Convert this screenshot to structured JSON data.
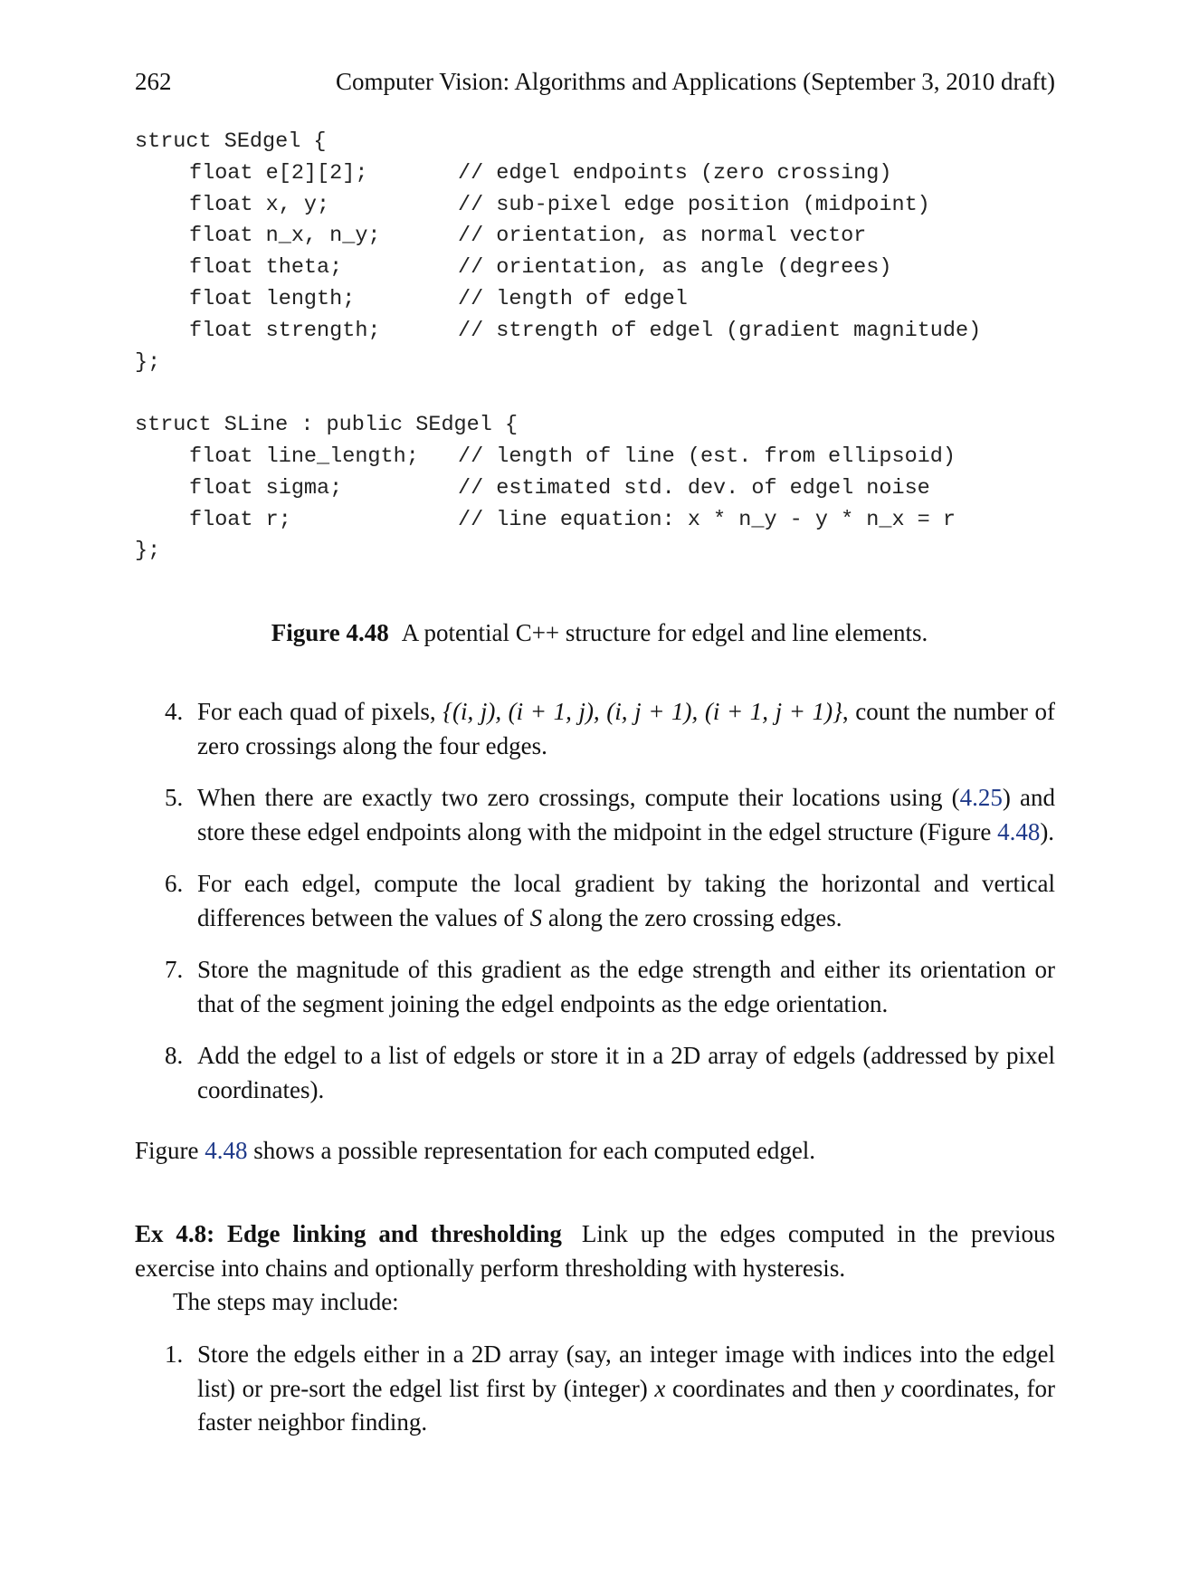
{
  "header": {
    "page_number": "262",
    "running_title": "Computer Vision: Algorithms and Applications (September 3, 2010 draft)"
  },
  "code": {
    "sedgel_open": "struct SEdgel {",
    "sedgel_fields": [
      {
        "decl": "float e[2][2];",
        "comment": "// edgel endpoints (zero crossing)"
      },
      {
        "decl": "float x, y;",
        "comment": "// sub-pixel edge position (midpoint)"
      },
      {
        "decl": "float n_x, n_y;",
        "comment": "// orientation, as normal vector"
      },
      {
        "decl": "float theta;",
        "comment": "// orientation, as angle (degrees)"
      },
      {
        "decl": "float length;",
        "comment": "// length of edgel"
      },
      {
        "decl": "float strength;",
        "comment": "// strength of edgel (gradient magnitude)"
      }
    ],
    "sedgel_close": "};",
    "sline_open": "struct SLine : public SEdgel {",
    "sline_fields": [
      {
        "decl": "float line_length;",
        "comment": "// length of line (est. from ellipsoid)"
      },
      {
        "decl": "float sigma;",
        "comment": "// estimated std. dev. of edgel noise"
      },
      {
        "decl": "float r;",
        "comment": "// line equation: x * n_y - y * n_x = r"
      }
    ],
    "sline_close": "};"
  },
  "caption": {
    "label": "Figure 4.48",
    "text": "A potential C++ structure for edgel and line elements."
  },
  "steps_a": [
    {
      "num": "4.",
      "pre": "For each quad of pixels, ",
      "math": "{(i, j), (i + 1, j), (i, j + 1), (i + 1, j + 1)}",
      "post": ", count the number of zero crossings along the four edges."
    },
    {
      "num": "5.",
      "pre": "When there are exactly two zero crossings, compute their locations using (",
      "ref1": "4.25",
      "mid": ") and store these edgel endpoints along with the midpoint in the edgel structure (Figure ",
      "ref2": "4.48",
      "post": ")."
    },
    {
      "num": "6.",
      "pre": "For each edgel, compute the local gradient by taking the horizontal and vertical differences between the values of ",
      "math": "S",
      "post": " along the zero crossing edges."
    },
    {
      "num": "7.",
      "text": "Store the magnitude of this gradient as the edge strength and either its orientation or that of the segment joining the edgel endpoints as the edge orientation."
    },
    {
      "num": "8.",
      "text": "Add the edgel to a list of edgels or store it in a 2D array of edgels (addressed by pixel coordinates)."
    }
  ],
  "summary": {
    "pre": "Figure ",
    "ref": "4.48",
    "post": " shows a possible representation for each computed edgel."
  },
  "exercise": {
    "title": "Ex 4.8: Edge linking and thresholding",
    "text": "Link up the edges computed in the previous exercise into chains and optionally perform thresholding with hysteresis.",
    "steps_intro": "The steps may include:"
  },
  "steps_b": [
    {
      "num": "1.",
      "pre": "Store the edgels either in a 2D array (say, an integer image with indices into the edgel list) or pre-sort the edgel list first by (integer) ",
      "math1": "x",
      "mid": " coordinates and then ",
      "math2": "y",
      "post": " coordinates, for faster neighbor finding."
    }
  ]
}
